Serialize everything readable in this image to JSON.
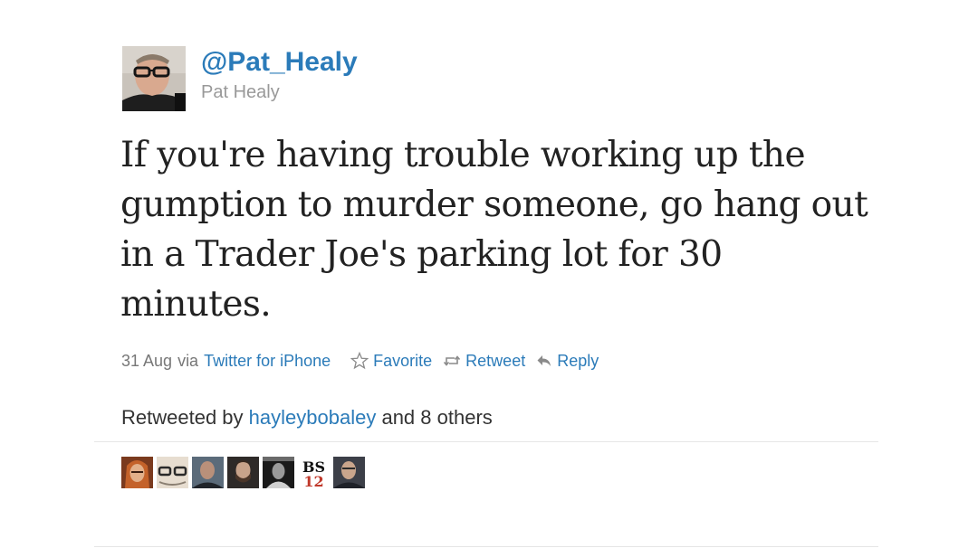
{
  "tweet": {
    "handle": "@Pat_Healy",
    "name": "Pat Healy",
    "text": "If you're having trouble working up the gumption to murder someone, go hang out in a Trader Joe's parking lot for 30 minutes.",
    "date": "31 Aug",
    "via_label": "via",
    "source": "Twitter for iPhone"
  },
  "actions": {
    "favorite": "Favorite",
    "retweet": "Retweet",
    "reply": "Reply"
  },
  "retweets": {
    "prefix": "Retweeted by",
    "user": "hayleybobaley",
    "suffix": "and 8 others"
  },
  "retweeter_avatars": [
    {
      "icon": "avatar-1"
    },
    {
      "icon": "avatar-2"
    },
    {
      "icon": "avatar-3"
    },
    {
      "icon": "avatar-4"
    },
    {
      "icon": "avatar-5"
    },
    {
      "icon": "avatar-6",
      "text_top": "BS",
      "text_bottom": "12"
    },
    {
      "icon": "avatar-7"
    }
  ],
  "colors": {
    "link": "#2b7bb9",
    "text": "#222222",
    "muted": "#999999"
  }
}
